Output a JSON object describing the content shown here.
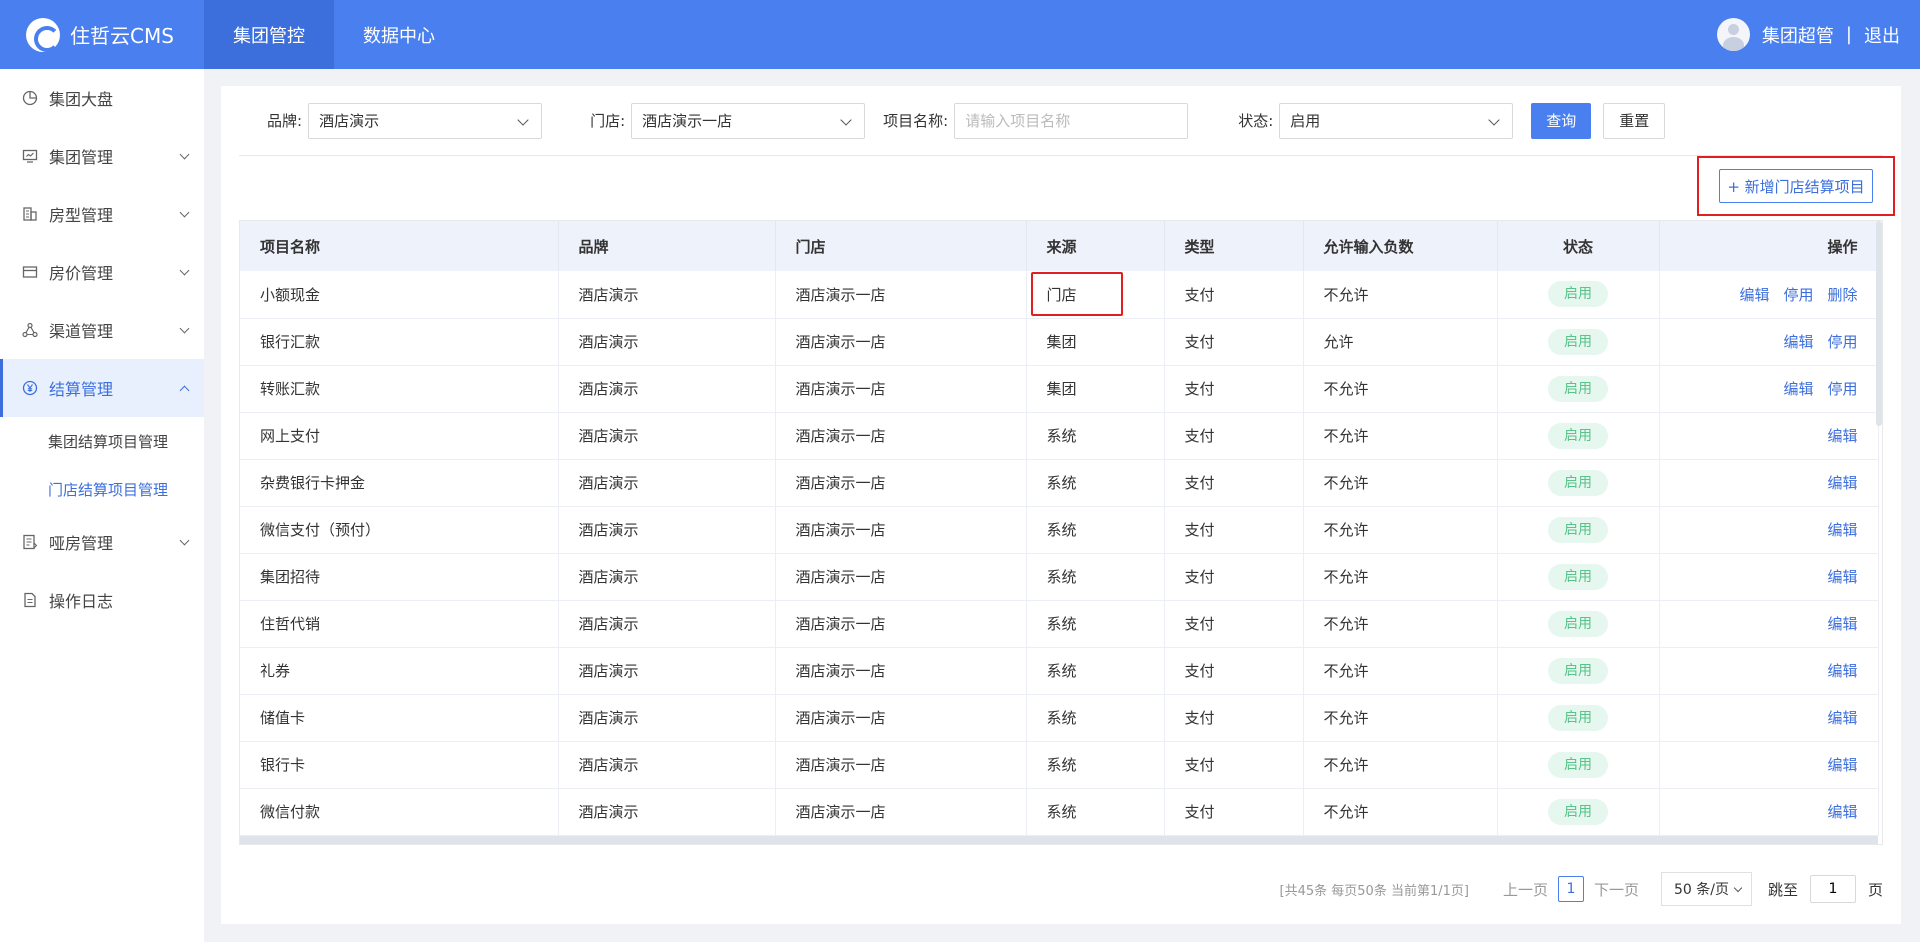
{
  "header": {
    "logo_text": "住哲云CMS",
    "nav": [
      "集团管控",
      "数据中心"
    ],
    "user_name": "集团超管",
    "separator": "|",
    "logout": "退出"
  },
  "sidebar": {
    "items": [
      {
        "label": "集团大盘",
        "icon": "pie-chart-icon"
      },
      {
        "label": "集团管理",
        "icon": "monitor-icon"
      },
      {
        "label": "房型管理",
        "icon": "building-icon"
      },
      {
        "label": "房价管理",
        "icon": "card-icon"
      },
      {
        "label": "渠道管理",
        "icon": "network-icon"
      },
      {
        "label": "结算管理",
        "icon": "yen-icon"
      },
      {
        "label": "哑房管理",
        "icon": "document-list-icon"
      },
      {
        "label": "操作日志",
        "icon": "document-icon"
      }
    ],
    "sub_items": [
      "集团结算项目管理",
      "门店结算项目管理"
    ]
  },
  "filters": {
    "brand_label": "品牌:",
    "brand_value": "酒店演示",
    "store_label": "门店:",
    "store_value": "酒店演示一店",
    "name_label": "项目名称:",
    "name_placeholder": "请输入项目名称",
    "status_label": "状态:",
    "status_value": "启用",
    "query": "查询",
    "reset": "重置"
  },
  "add_button": "+ 新增门店结算项目",
  "table": {
    "headers": [
      "项目名称",
      "品牌",
      "门店",
      "来源",
      "类型",
      "允许输入负数",
      "状态",
      "操作"
    ],
    "actions": {
      "edit": "编辑",
      "disable": "停用",
      "delete": "删除"
    },
    "rows": [
      {
        "name": "小额现金",
        "brand": "酒店演示",
        "store": "酒店演示一店",
        "source": "门店",
        "type": "支付",
        "negative": "不允许",
        "status": "启用"
      },
      {
        "name": "银行汇款",
        "brand": "酒店演示",
        "store": "酒店演示一店",
        "source": "集团",
        "type": "支付",
        "negative": "允许",
        "status": "启用"
      },
      {
        "name": "转账汇款",
        "brand": "酒店演示",
        "store": "酒店演示一店",
        "source": "集团",
        "type": "支付",
        "negative": "不允许",
        "status": "启用"
      },
      {
        "name": "网上支付",
        "brand": "酒店演示",
        "store": "酒店演示一店",
        "source": "系统",
        "type": "支付",
        "negative": "不允许",
        "status": "启用"
      },
      {
        "name": "杂费银行卡押金",
        "brand": "酒店演示",
        "store": "酒店演示一店",
        "source": "系统",
        "type": "支付",
        "negative": "不允许",
        "status": "启用"
      },
      {
        "name": "微信支付（预付）",
        "brand": "酒店演示",
        "store": "酒店演示一店",
        "source": "系统",
        "type": "支付",
        "negative": "不允许",
        "status": "启用"
      },
      {
        "name": "集团招待",
        "brand": "酒店演示",
        "store": "酒店演示一店",
        "source": "系统",
        "type": "支付",
        "negative": "不允许",
        "status": "启用"
      },
      {
        "name": "住哲代销",
        "brand": "酒店演示",
        "store": "酒店演示一店",
        "source": "系统",
        "type": "支付",
        "negative": "不允许",
        "status": "启用"
      },
      {
        "name": "礼券",
        "brand": "酒店演示",
        "store": "酒店演示一店",
        "source": "系统",
        "type": "支付",
        "negative": "不允许",
        "status": "启用"
      },
      {
        "name": "储值卡",
        "brand": "酒店演示",
        "store": "酒店演示一店",
        "source": "系统",
        "type": "支付",
        "negative": "不允许",
        "status": "启用"
      },
      {
        "name": "银行卡",
        "brand": "酒店演示",
        "store": "酒店演示一店",
        "source": "系统",
        "type": "支付",
        "negative": "不允许",
        "status": "启用"
      },
      {
        "name": "微信付款",
        "brand": "酒店演示",
        "store": "酒店演示一店",
        "source": "系统",
        "type": "支付",
        "negative": "不允许",
        "status": "启用"
      }
    ]
  },
  "pagination": {
    "summary": "[共45条 每页50条 当前第1/1页]",
    "prev": "上一页",
    "page": "1",
    "next": "下一页",
    "page_size": "50 条/页",
    "jump_label": "跳至",
    "jump_value": "1",
    "page_suffix": "页"
  },
  "colors": {
    "primary": "#4a7ff0",
    "highlight": "#e02020",
    "badge_bg": "#e5f7ee",
    "badge_text": "#58c38a"
  }
}
